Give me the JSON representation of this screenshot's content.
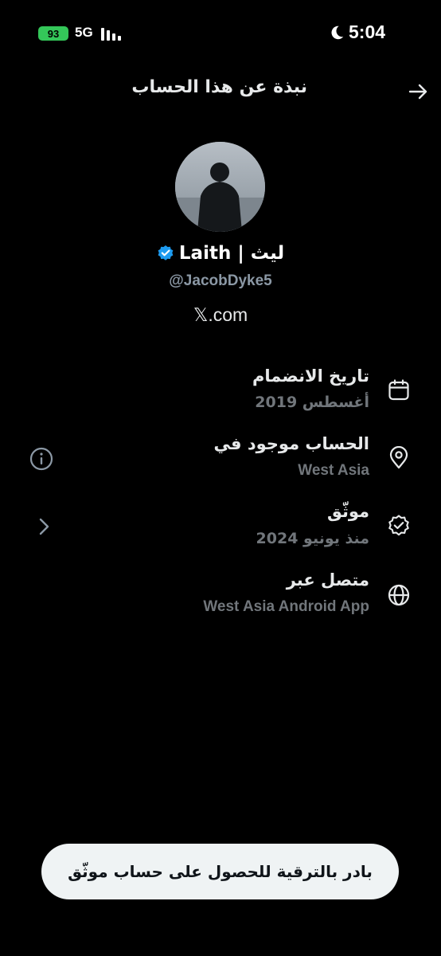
{
  "status_bar": {
    "battery": "93",
    "network": "5G",
    "time": "5:04"
  },
  "header": {
    "title": "نبذة عن هذا الحساب"
  },
  "profile": {
    "display_name": "Laith | ليث",
    "handle": "@JacobDyke5",
    "website": "𝕏.com"
  },
  "details": {
    "joined": {
      "label": "تاريخ الانضمام",
      "value": "أغسطس 2019"
    },
    "location": {
      "label": "الحساب موجود في",
      "value": "West Asia"
    },
    "verified": {
      "label": "موثّق",
      "value": "منذ يونيو 2024"
    },
    "connected": {
      "label": "متصل عبر",
      "value": "West Asia Android App"
    }
  },
  "upgrade_button": {
    "label": "بادر بالترقية للحصول على حساب موثّق"
  },
  "colors": {
    "background": "#000000",
    "verified_blue": "#1d9bf0",
    "muted": "#71767b",
    "battery_green": "#34c759"
  }
}
